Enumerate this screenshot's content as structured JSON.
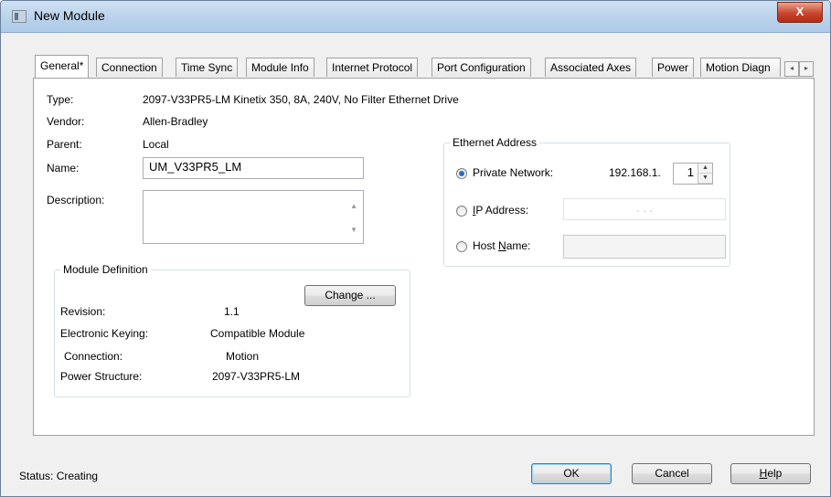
{
  "window": {
    "title": "New Module",
    "close_glyph": "X"
  },
  "tabs": [
    {
      "label": "General*"
    },
    {
      "label": "Connection"
    },
    {
      "label": "Time Sync"
    },
    {
      "label": "Module Info"
    },
    {
      "label": "Internet Protocol"
    },
    {
      "label": "Port Configuration"
    },
    {
      "label": "Associated Axes"
    },
    {
      "label": "Power"
    },
    {
      "label": "Motion Diagn"
    }
  ],
  "tab_scroll": {
    "left": "◂",
    "right": "▸"
  },
  "general": {
    "type_label": "Type:",
    "type_value": "2097-V33PR5-LM Kinetix 350, 8A, 240V, No Filter Ethernet Drive",
    "vendor_label": "Vendor:",
    "vendor_value": "Allen-Bradley",
    "parent_label": "Parent:",
    "parent_value": "Local",
    "name_label": "Name:",
    "name_value": "UM_V33PR5_LM",
    "description_label": "Description:",
    "description_value": ""
  },
  "ethernet": {
    "group_title": "Ethernet Address",
    "private_network_label": "Private Network:",
    "private_network_prefix": "192.168.1.",
    "private_network_host": "1",
    "ip_address_label": "IP Address:",
    "ip_address_dots": ".        .        .",
    "host_name_label": "Host Name:",
    "host_name_value": "",
    "selected": "private_network"
  },
  "module_definition": {
    "group_title": "Module Definition",
    "change_button": "Change ...",
    "revision_label": "Revision:",
    "revision_value": "1.1",
    "keying_label": "Electronic Keying:",
    "keying_value": "Compatible Module",
    "connection_label": "Connection:",
    "connection_value": "Motion",
    "power_structure_label": "Power Structure:",
    "power_structure_value": "2097-V33PR5-LM"
  },
  "footer": {
    "status_label": "Status:",
    "status_value": "Creating",
    "ok_button": "OK",
    "cancel_button": "Cancel",
    "help_button": "Help"
  },
  "icons": {
    "spin_up": "▲",
    "spin_down": "▼",
    "scroll_up": "▲",
    "scroll_down": "▼"
  }
}
